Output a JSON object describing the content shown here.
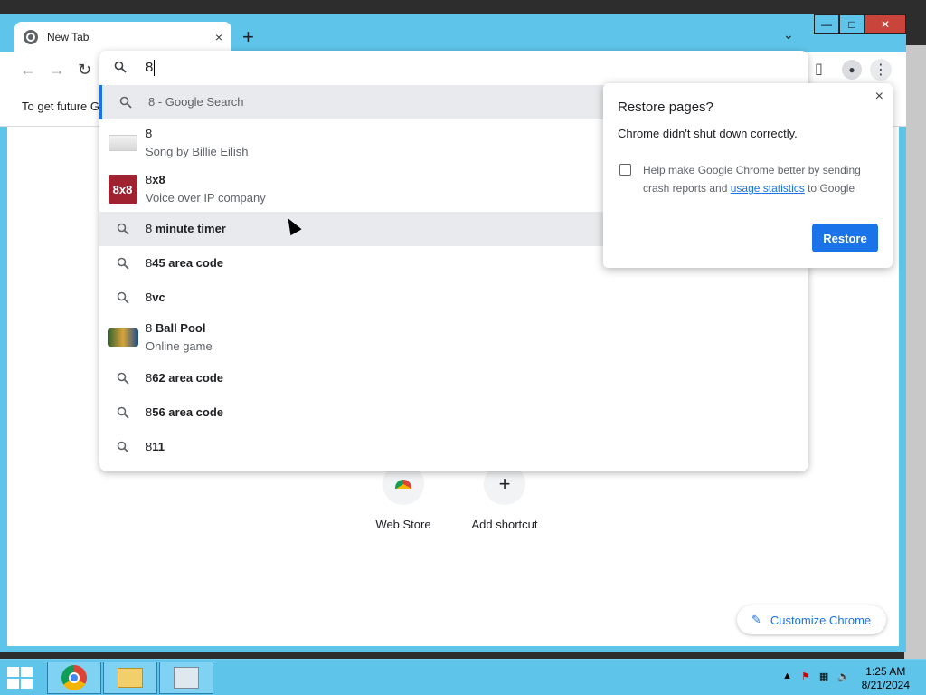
{
  "window": {
    "tab_title": "New Tab",
    "new_tab": "+",
    "tab_close": "×",
    "minimize": "—",
    "maximize": "□",
    "close": "✕"
  },
  "toolbar": {
    "back": "←",
    "forward": "→",
    "reload": "↻",
    "omnibox_text": "8"
  },
  "infobar": {
    "text": "To get future G"
  },
  "suggestions": [
    {
      "prefix": "8",
      "rest": " - Google Search",
      "type": "search"
    },
    {
      "title": "8",
      "subtitle": "Song by Billie Eilish",
      "type": "entity-song"
    },
    {
      "prefix": "8",
      "bold": "x8",
      "subtitle": "Voice over IP company",
      "type": "entity-8x8",
      "thumb": "8x8"
    },
    {
      "prefix": "8 ",
      "bold": "minute timer",
      "type": "search"
    },
    {
      "prefix": "8",
      "bold": "45 area code",
      "type": "search"
    },
    {
      "prefix": "8",
      "bold": "vc",
      "type": "search"
    },
    {
      "prefix": "8 ",
      "bold": "Ball Pool",
      "subtitle": "Online game",
      "type": "entity-pool"
    },
    {
      "prefix": "8",
      "bold": "62 area code",
      "type": "search"
    },
    {
      "prefix": "8",
      "bold": "56 area code",
      "type": "search"
    },
    {
      "prefix": "8",
      "bold": "11",
      "type": "search"
    }
  ],
  "restore_dialog": {
    "title": "Restore pages?",
    "message": "Chrome didn't shut down correctly.",
    "help_part1": "Help make Google Chrome better by sending crash reports and ",
    "help_link": "usage statistics",
    "help_part2": " to Google",
    "button": "Restore",
    "close": "×"
  },
  "shortcuts": [
    {
      "label": "Web Store"
    },
    {
      "label": "Add shortcut",
      "icon": "+"
    }
  ],
  "customize": {
    "label": "Customize Chrome"
  },
  "taskbar": {
    "time": "1:25 AM",
    "date": "8/21/2024",
    "tray_arrow": "▲"
  },
  "colors": {
    "accent": "#1a73e8",
    "window_frame": "#5fc4ea",
    "close_button": "#c9443b"
  }
}
